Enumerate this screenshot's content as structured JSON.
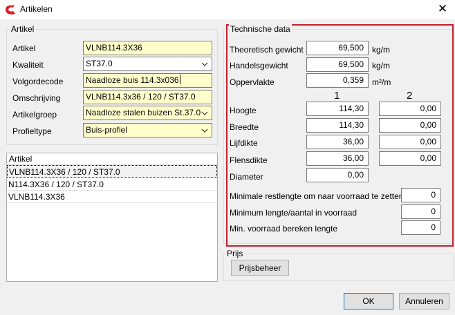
{
  "window": {
    "title": "Artikelen",
    "close_glyph": "✕",
    "icon": "app-logo-icon",
    "icon_color": "#d81f26"
  },
  "artikel_group": {
    "label": "Artikel",
    "fields": {
      "artikel": {
        "label": "Artikel",
        "value": "VLNB114.3X36"
      },
      "kwaliteit": {
        "label": "Kwaliteit",
        "value": "ST37.0"
      },
      "volgordecode": {
        "label": "Volgordecode",
        "value": "Naadloze buis 114.3x036"
      },
      "omschrijving": {
        "label": "Omschrijving",
        "value": "VLNB114.3x36 / 120 / ST37.0"
      },
      "artikelgroep": {
        "label": "Artikelgroep",
        "value": "Naadloze stalen buizen St.37.0"
      },
      "profieltype": {
        "label": "Profieltype",
        "value": "Buis-profiel"
      }
    }
  },
  "artikel_list": {
    "header": "Artikel",
    "items": [
      "VLNB114.3X36 / 120 / ST37.0",
      "N114.3X36 / 120 / ST37.0",
      "VLNB114.3X36"
    ]
  },
  "technische_data": {
    "label": "Technische data",
    "col1_header": "1",
    "col2_header": "2",
    "theoretisch_gewicht": {
      "label": "Theoretisch gewicht",
      "value": "69,500",
      "unit": "kg/m"
    },
    "handelsgewicht": {
      "label": "Handelsgewicht",
      "value": "69,500",
      "unit": "kg/m"
    },
    "oppervlakte": {
      "label": "Oppervlakte",
      "value": "0,359",
      "unit": "m²/m"
    },
    "hoogte": {
      "label": "Hoogte",
      "v1": "114,30",
      "v2": "0,00"
    },
    "breedte": {
      "label": "Breedte",
      "v1": "114,30",
      "v2": "0,00"
    },
    "lijfdikte": {
      "label": "Lijfdikte",
      "v1": "36,00",
      "v2": "0,00"
    },
    "flensdikte": {
      "label": "Flensdikte",
      "v1": "36,00",
      "v2": "0,00"
    },
    "diameter": {
      "label": "Diameter",
      "v1": "0,00"
    },
    "min_restlengte": {
      "label": "Minimale restlengte om naar voorraad te zetten",
      "value": "0"
    },
    "min_lengte_aantal": {
      "label": "Minimum lengte/aantal in voorraad",
      "value": "0"
    },
    "min_voorraad": {
      "label": "Min. voorraad bereken lengte",
      "value": "0"
    }
  },
  "prijs": {
    "label": "Prijs",
    "button": "Prijsbeheer"
  },
  "footer": {
    "ok": "OK",
    "cancel": "Annuleren"
  },
  "colors": {
    "field_yellow": "#ffffcc",
    "highlight_border": "#c0202f",
    "default_button_border": "#0078d7"
  }
}
